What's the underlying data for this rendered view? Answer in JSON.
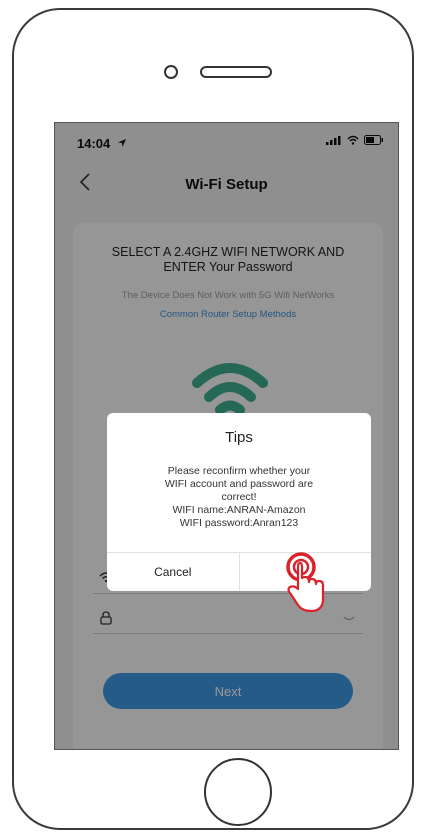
{
  "status_bar": {
    "time": "14:04"
  },
  "nav": {
    "title": "Wi-Fi Setup"
  },
  "card": {
    "heading_line1": "SELECT A 2.4GHZ WIFI NETWORK AND",
    "heading_line2": "ENTER Your Password",
    "note": "The Device Does Not Work with 5G Wifi NetWorks",
    "link": "Common Router Setup Methods"
  },
  "form": {
    "next_label": "Next"
  },
  "dialog": {
    "title": "Tips",
    "message_line1": "Please reconfirm whether your",
    "message_line2": "WIFI account and password are",
    "message_line3": "correct!",
    "wifi_name_line": "WIFI name:ANRAN-Amazon",
    "wifi_password_line": "WIFI password:Anran123",
    "cancel_label": "Cancel",
    "confirm_label": ""
  },
  "colors": {
    "accent": "#3d93dc",
    "wifi_icon": "#3aa88a",
    "tap_indicator": "#d8232a"
  }
}
